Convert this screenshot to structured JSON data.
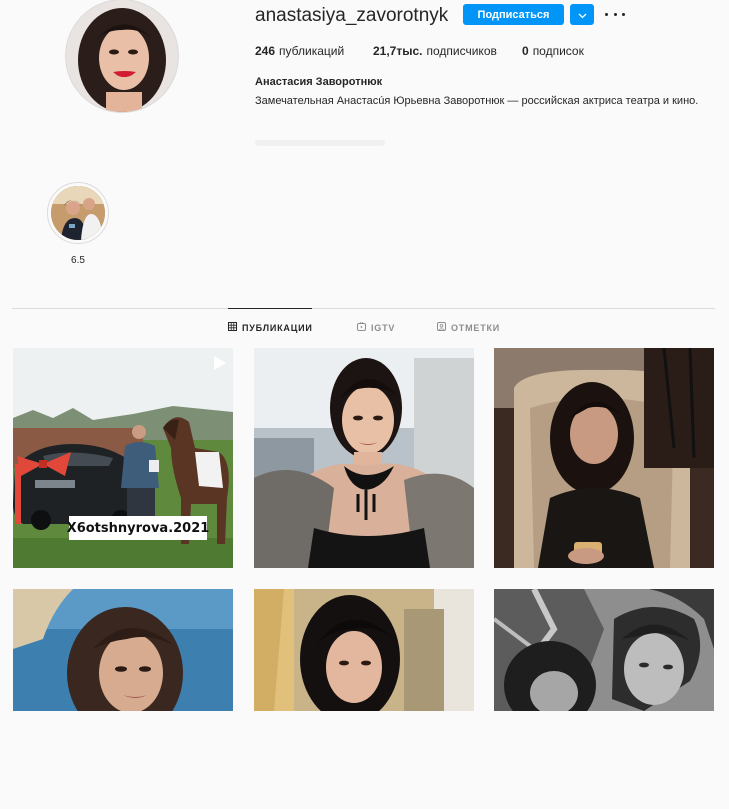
{
  "profile": {
    "username": "anastasiya_zavorotnyk",
    "follow_label": "Подписаться",
    "full_name": "Анастасия Заворотнюк",
    "bio": "Замечательная Анастасúя Юрьевна Заворотнюк — российская актриса театра и кино.",
    "stats": {
      "posts_count": "246",
      "posts_label": "публикаций",
      "followers_count": "21,7тыс.",
      "followers_label": "подписчиков",
      "following_count": "0",
      "following_label": "подписок"
    }
  },
  "highlights": [
    {
      "label": "6.5"
    }
  ],
  "tabs": [
    {
      "label": "ПУБЛИКАЦИИ",
      "icon": "grid-icon",
      "active": true
    },
    {
      "label": "IGTV",
      "icon": "igtv-icon",
      "active": false
    },
    {
      "label": "ОТМЕТКИ",
      "icon": "tagged-icon",
      "active": false
    }
  ],
  "posts": [
    {
      "type": "video",
      "overlay_text": "X6otshnyrova.2021"
    },
    {
      "type": "photo"
    },
    {
      "type": "photo"
    },
    {
      "type": "photo"
    },
    {
      "type": "photo"
    },
    {
      "type": "photo"
    }
  ],
  "colors": {
    "accent": "#0095f6",
    "background": "#fafafa",
    "text_primary": "#262626",
    "text_secondary": "#8e8e8e",
    "divider": "#dbdbdb"
  }
}
